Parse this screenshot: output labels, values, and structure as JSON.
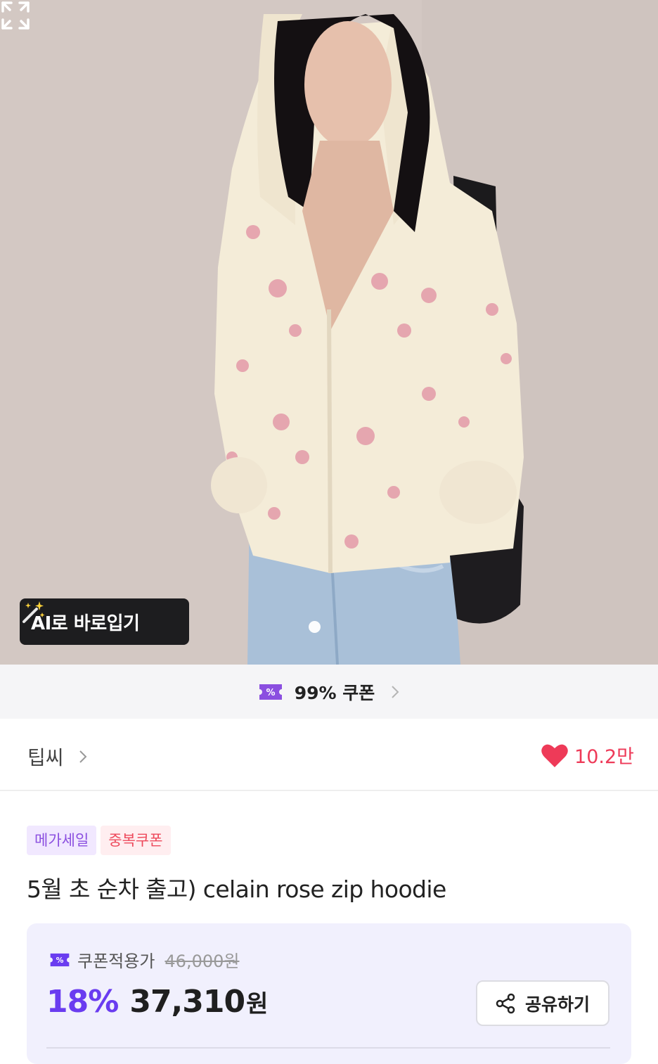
{
  "hero": {
    "ai_try_on_label": "AI로 바로입기",
    "carousel_position": 1,
    "icons": [
      "magic-wand-icon",
      "expand-icon"
    ]
  },
  "coupon_strip": {
    "text": "99% 쿠폰",
    "icons": [
      "coupon-icon",
      "chevron-right-icon"
    ]
  },
  "shop": {
    "name": "팁씨",
    "likes": "10.2만"
  },
  "badges": [
    "메가세일",
    "중복쿠폰"
  ],
  "product": {
    "title": "5월 초 순차 출고) celain rose zip hoodie"
  },
  "price": {
    "label": "쿠폰적용가",
    "original": "46,000원",
    "discount": "18%",
    "amount": "37,310",
    "currency": "원",
    "share_label": "공유하기"
  },
  "colors": {
    "accent": "#6a3cf0",
    "badge_purple": "#8b4fe0",
    "badge_red": "#ee4a5c",
    "heart": "#ee3a58"
  }
}
